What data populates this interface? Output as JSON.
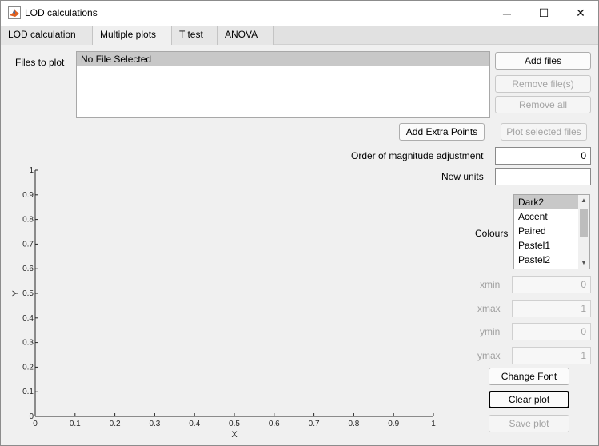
{
  "window": {
    "title": "LOD calculations",
    "controls": {
      "minimize": "─",
      "maximize": "☐",
      "close": "✕"
    }
  },
  "tabs": [
    {
      "label": "LOD calculation"
    },
    {
      "label": "Multiple plots"
    },
    {
      "label": "T test"
    },
    {
      "label": "ANOVA"
    }
  ],
  "files": {
    "label": "Files to plot",
    "items": [
      "No File Selected"
    ]
  },
  "buttons": {
    "add_files": "Add files",
    "remove_files": "Remove file(s)",
    "remove_all": "Remove all",
    "add_extra_points": "Add Extra Points",
    "plot_selected": "Plot selected files",
    "change_font": "Change Font",
    "clear_plot": "Clear plot",
    "save_plot": "Save plot"
  },
  "magnitude": {
    "label": "Order of magnitude adjustment",
    "value": "0"
  },
  "new_units": {
    "label": "New units",
    "value": ""
  },
  "colours": {
    "label": "Colours",
    "options": [
      "Dark2",
      "Accent",
      "Paired",
      "Pastel1",
      "Pastel2"
    ],
    "selected": "Dark2"
  },
  "limits": {
    "xmin": {
      "label": "xmin",
      "value": "0"
    },
    "xmax": {
      "label": "xmax",
      "value": "1"
    },
    "ymin": {
      "label": "ymin",
      "value": "0"
    },
    "ymax": {
      "label": "ymax",
      "value": "1"
    }
  },
  "chart_data": {
    "type": "line",
    "series": [],
    "xlabel": "X",
    "ylabel": "Y",
    "xlim": [
      0,
      1
    ],
    "ylim": [
      0,
      1
    ],
    "xticks": [
      "0",
      "0.1",
      "0.2",
      "0.3",
      "0.4",
      "0.5",
      "0.6",
      "0.7",
      "0.8",
      "0.9",
      "1"
    ],
    "yticks": [
      "0",
      "0.1",
      "0.2",
      "0.3",
      "0.4",
      "0.5",
      "0.6",
      "0.7",
      "0.8",
      "0.9",
      "1"
    ],
    "grid": false
  }
}
